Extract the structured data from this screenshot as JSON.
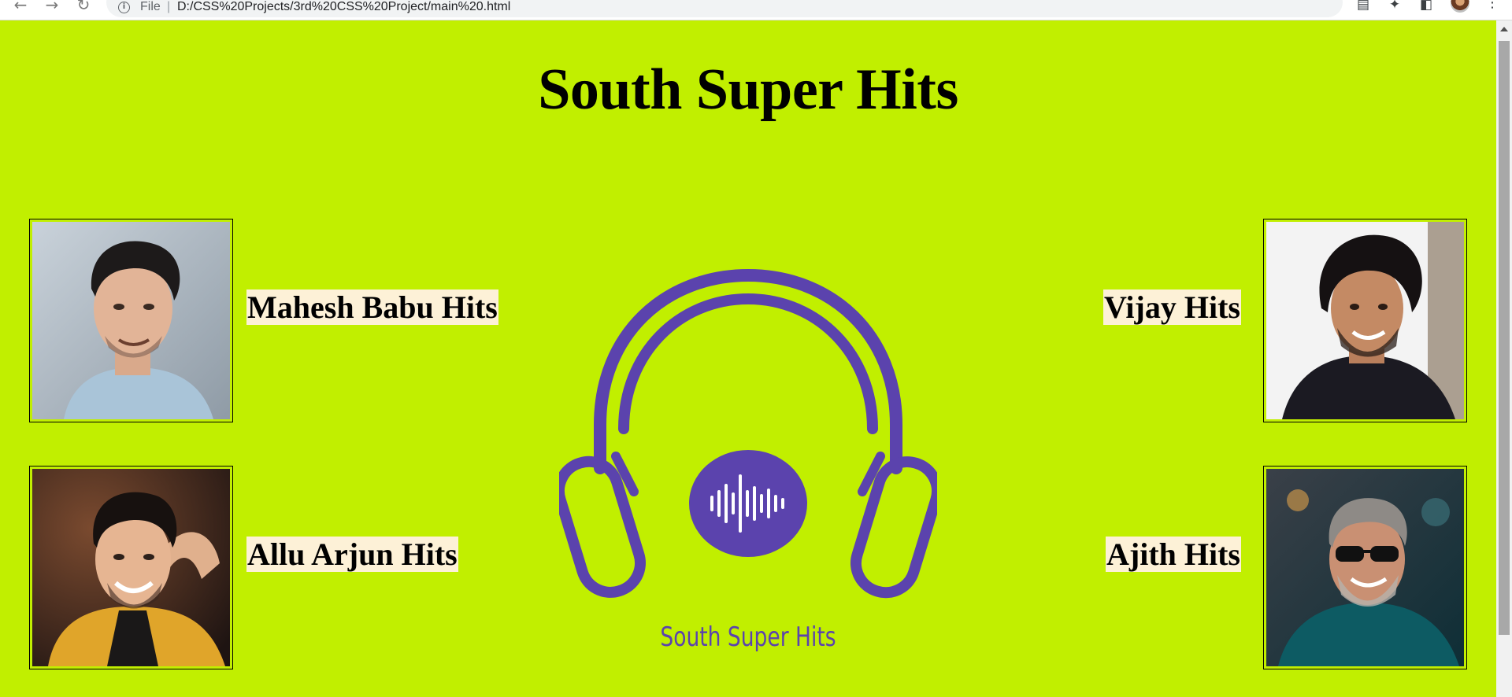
{
  "browser": {
    "url_scheme": "File",
    "url": "D:/CSS%20Projects/3rd%20CSS%20Project/main%20.html"
  },
  "page": {
    "title": "South Super Hits",
    "background_color": "#c1ef00",
    "label_background_color": "#fdf1d7",
    "accent_color": "#5b43ad"
  },
  "artists": [
    {
      "label": "Mahesh Babu Hits",
      "side": "left",
      "row": "top"
    },
    {
      "label": "Allu Arjun Hits",
      "side": "left",
      "row": "bottom"
    },
    {
      "label": "Vijay Hits",
      "side": "right",
      "row": "top"
    },
    {
      "label": "Ajith Hits",
      "side": "right",
      "row": "bottom"
    }
  ],
  "logo": {
    "caption": "South Super Hits",
    "icon": "headphones-icon"
  }
}
